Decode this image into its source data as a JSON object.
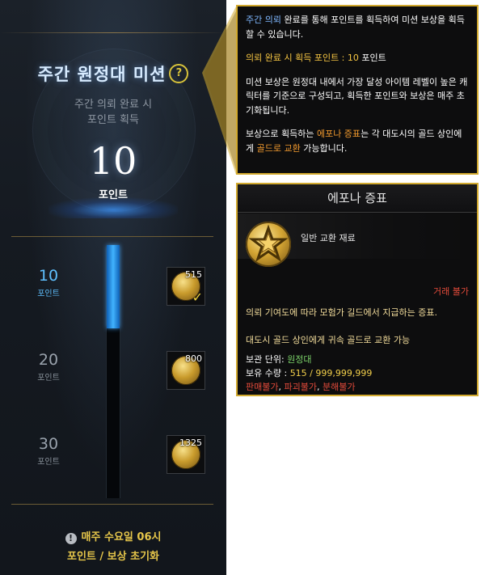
{
  "mission": {
    "title": "주간 원정대 미션",
    "help_icon": "?",
    "subtitle_line1": "주간 의뢰 완료 시",
    "subtitle_line2": "포인트 획득",
    "points_value": "10",
    "points_label": "포인트",
    "progress_fraction": 0.33,
    "tiers": [
      {
        "points": "10",
        "unit": "포인트",
        "reward_count": "515",
        "claimed": true,
        "active": true
      },
      {
        "points": "20",
        "unit": "포인트",
        "reward_count": "800",
        "claimed": false,
        "active": false
      },
      {
        "points": "30",
        "unit": "포인트",
        "reward_count": "1325",
        "claimed": false,
        "active": false
      }
    ],
    "reset_line1": "매주 수요일 06시",
    "reset_line2": "포인트 / 보상 초기화",
    "info_icon": "!"
  },
  "help_tooltip": {
    "p1_a": "주간 의뢰",
    "p1_b": " 완료를 통해 포인트를 획득하여 미션 보상을 획득할 수 있습니다.",
    "p2_label": "의뢰 완료 시 획득 포인트 : ",
    "p2_value": "10",
    "p2_unit": " 포인트",
    "p3": "미션 보상은 원정대 내에서 가장 달성 아이템 레벨이 높은 캐릭터를 기준으로 구성되고, 획득한 포인트와 보상은 매주 초기화됩니다.",
    "p4_a": "보상으로 획득하는 ",
    "p4_b": "에포나 증표",
    "p4_c": "는 각 대도시의 골드 상인에게 ",
    "p4_d": "골드로 교환",
    "p4_e": " 가능합니다."
  },
  "item_tooltip": {
    "name": "에포나 증표",
    "grade": "일반 교환 재료",
    "trade": "거래 불가",
    "description": "의뢰 기여도에 따라 모험가 길드에서 지급하는 증표.",
    "exchange": "대도시 골드 상인에게 귀속 골드로 교환 가능",
    "storage_label": "보관 단위: ",
    "storage_value": "원정대",
    "holdings_label": "보유 수량 : ",
    "holdings_value": "515 / 999,999,999",
    "restrict_1": "판매불가",
    "restrict_2": "파괴불가",
    "restrict_3": "분해불가",
    "restrict_sep": ", "
  },
  "colors": {
    "frame_gold": "#d2a92e",
    "active_blue": "#5fc0ff",
    "warning_red": "#e24a3a",
    "reset_gold": "#e6c64a"
  },
  "icons": [
    "help-icon",
    "coin-icon",
    "check-icon",
    "info-icon",
    "epona-token-icon"
  ]
}
